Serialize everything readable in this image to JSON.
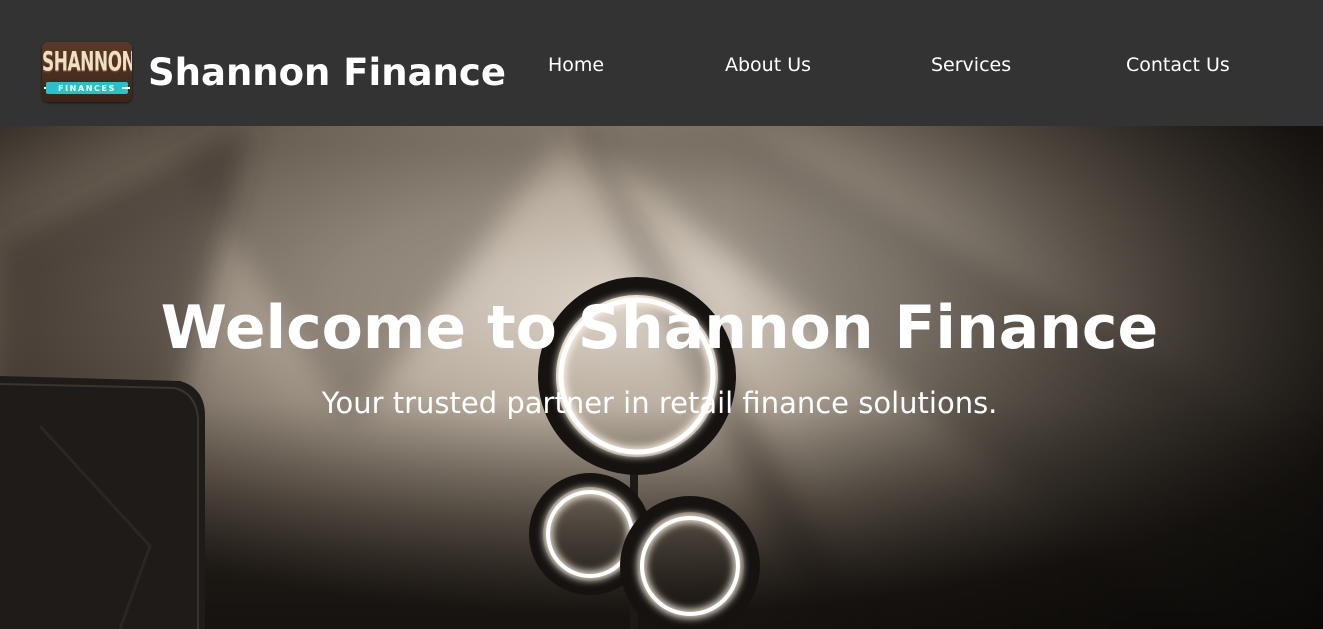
{
  "header": {
    "logo": {
      "top_text": "SHANNON",
      "bottom_text": "FINANCES"
    },
    "site_title": "Shannon Finance",
    "nav": [
      {
        "label": "Home"
      },
      {
        "label": "About Us"
      },
      {
        "label": "Services"
      },
      {
        "label": "Contact Us"
      }
    ]
  },
  "hero": {
    "title": "Welcome to Shannon Finance",
    "subtitle": "Your trusted partner in retail finance solutions.",
    "image": "ring-lamp-photo"
  },
  "colors": {
    "nav_background": "#333333",
    "text": "#ffffff",
    "logo_accent": "#25c4c4",
    "logo_background": "#4a2f1e"
  }
}
